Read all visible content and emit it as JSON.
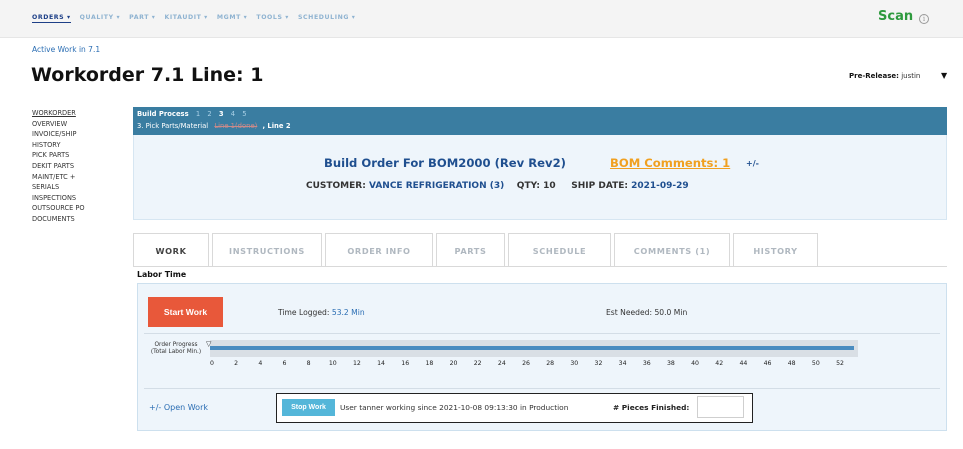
{
  "topnav": {
    "menus": [
      "ORDERS ▾",
      "QUALITY ▾",
      "PART ▾",
      "KITAUDIT ▾",
      "MGMT ▾",
      "TOOLS ▾",
      "SCHEDULING ▾"
    ],
    "scan_label": "Scan",
    "info_glyph": "i"
  },
  "breadcrumb": "Active Work in 7.1",
  "page_title": "Workorder 7.1 Line: 1",
  "prerelease": {
    "label": "Pre-Release:",
    "value": "justin",
    "caret": "▼"
  },
  "sidenav": [
    "WORKORDER",
    "OVERVIEW",
    "INVOICE/SHIP",
    "HISTORY",
    "PICK PARTS",
    "DEKIT PARTS",
    "MAINT/ETC +",
    "SERIALS",
    "INSPECTIONS",
    "OUTSOURCE PO",
    "DOCUMENTS"
  ],
  "build_process": {
    "label": "Build Process",
    "steps": [
      "1",
      "2",
      "3",
      "4",
      "5"
    ],
    "current_step": "3",
    "current_step_text": "3. Pick Parts/Material",
    "done_line": "Line 1(done)",
    "active_line": ", Line 2"
  },
  "build_info": {
    "build_order": "Build Order For BOM2000 (Rev Rev2)",
    "bom_comments": "BOM Comments: 1",
    "plus_minus": "+/-",
    "customer_label": "CUSTOMER:",
    "customer_value": "VANCE REFRIGERATION (3)",
    "qty_label": "QTY:",
    "qty_value": "10",
    "ship_label": "SHIP DATE:",
    "ship_value": "2021-09-29"
  },
  "tabs": [
    {
      "label": "WORK",
      "active": true
    },
    {
      "label": "INSTRUCTIONS",
      "active": false
    },
    {
      "label": "ORDER INFO",
      "active": false
    },
    {
      "label": "PARTS",
      "active": false
    },
    {
      "label": "SCHEDULE",
      "active": false
    },
    {
      "label": "COMMENTS (1)",
      "active": false
    },
    {
      "label": "HISTORY",
      "active": false
    }
  ],
  "labor": {
    "title": "Labor Time",
    "start_button": "Start Work",
    "time_logged_label": "Time Logged:",
    "time_logged_value": "53.2 Min",
    "est_needed": "Est Needed: 50.0 Min",
    "progress_label_1": "Order Progress",
    "progress_label_2": "(Total Labor Min.)",
    "progress_value_min": 53.2,
    "progress_max_min": 52,
    "marker_glyph": "▽",
    "ticks": [
      "0",
      "2",
      "4",
      "6",
      "8",
      "10",
      "12",
      "14",
      "16",
      "18",
      "20",
      "22",
      "24",
      "26",
      "28",
      "30",
      "32",
      "34",
      "36",
      "38",
      "40",
      "42",
      "44",
      "46",
      "48",
      "50",
      "52"
    ]
  },
  "work": {
    "open_work": "+/- Open Work",
    "stop_button": "Stop Work",
    "status": "User tanner working since 2021-10-08 09:13:30 in Production",
    "pieces_label": "# Pieces Finished:",
    "pieces_value": ""
  },
  "colors": {
    "brand_bar": "#3a7da1",
    "start_button": "#e8583a",
    "stop_button": "#54b6d9",
    "scan": "#2e9a3e",
    "bom_comments": "#f0a020"
  }
}
